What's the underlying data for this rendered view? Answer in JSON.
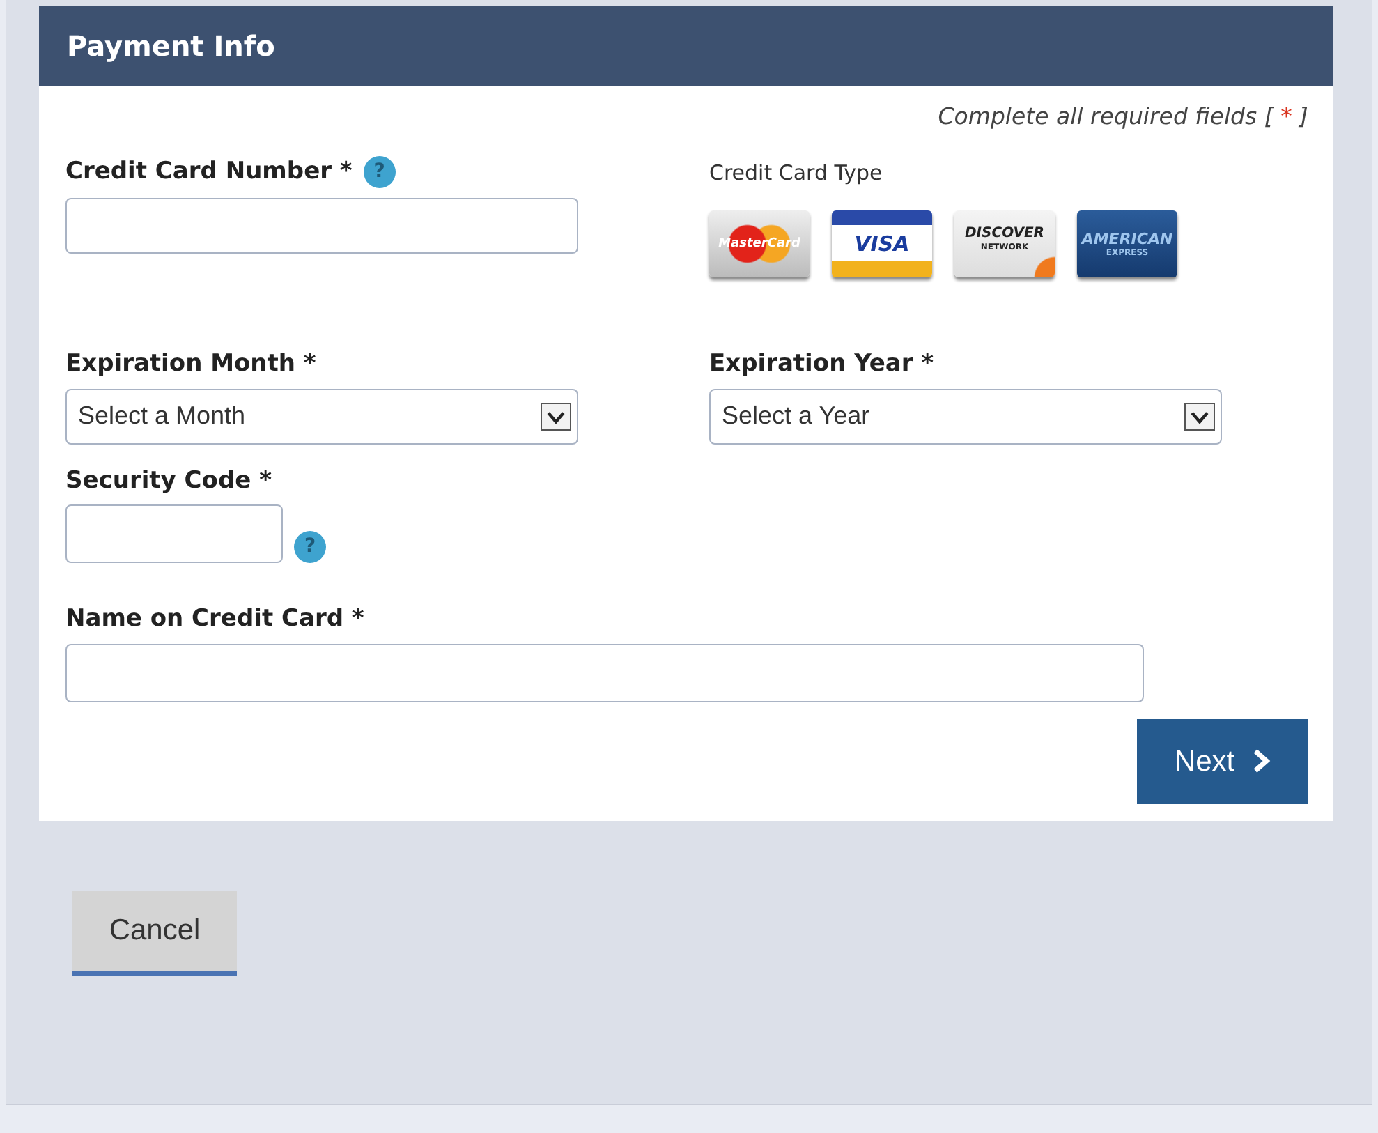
{
  "panel": {
    "title": "Payment Info",
    "required_note": "Complete all required fields [",
    "required_mark": "*",
    "required_close": "]"
  },
  "card_number": {
    "label": "Credit Card Number *",
    "help": "?"
  },
  "card_type": {
    "label": "Credit Card Type",
    "cards": [
      {
        "kind": "mastercard",
        "lines": [
          "MasterCard"
        ]
      },
      {
        "kind": "visa",
        "lines": [
          "VISA"
        ]
      },
      {
        "kind": "discover",
        "lines": [
          "DISCOVER",
          "NETWORK"
        ]
      },
      {
        "kind": "amex",
        "lines": [
          "AMERICAN",
          "EXPRESS"
        ]
      }
    ]
  },
  "expiration_month": {
    "label": "Expiration Month *",
    "value": "Select a Month"
  },
  "expiration_year": {
    "label": "Expiration Year *",
    "value": "Select a Year"
  },
  "security_code": {
    "label": "Security Code *",
    "help": "?"
  },
  "name_on_card": {
    "label": "Name on Credit Card *"
  },
  "buttons": [
    {
      "kind": "next",
      "label": "Next"
    },
    {
      "kind": "cancel",
      "label": "Cancel"
    }
  ]
}
